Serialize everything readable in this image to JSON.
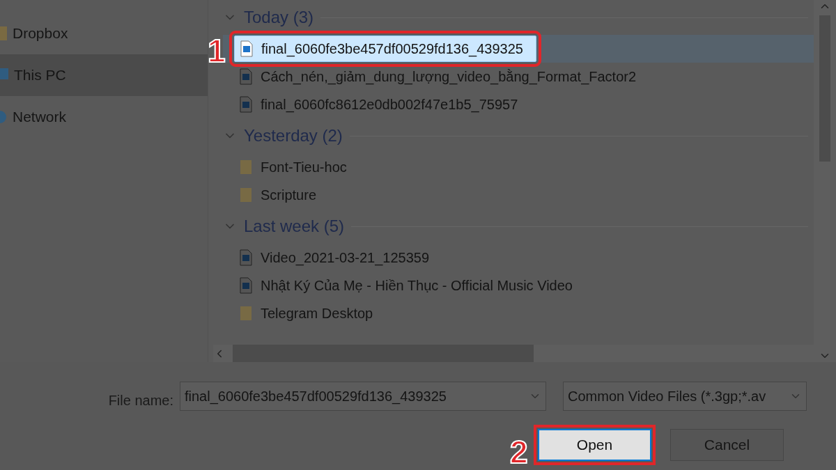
{
  "sidebar": {
    "items": [
      {
        "label": "Dropbox",
        "kind": "dropbox",
        "selected": false
      },
      {
        "label": "This PC",
        "kind": "pc",
        "selected": true
      },
      {
        "label": "Network",
        "kind": "network",
        "selected": false
      }
    ]
  },
  "groups": [
    {
      "title": "Today (3)",
      "expanded": true,
      "items": [
        {
          "name": "final_6060fe3be457df00529fd136_439325",
          "kind": "video",
          "selected": true,
          "step": "1"
        },
        {
          "name": "Cách_nén,_giảm_dung_lượng_video_bằng_Format_Factor2",
          "kind": "video",
          "selected": false
        },
        {
          "name": "final_6060fc8612e0db002f47e1b5_75957",
          "kind": "video",
          "selected": false
        }
      ]
    },
    {
      "title": "Yesterday (2)",
      "expanded": true,
      "items": [
        {
          "name": "Font-Tieu-hoc",
          "kind": "folder",
          "selected": false
        },
        {
          "name": "Scripture",
          "kind": "folder",
          "selected": false
        }
      ]
    },
    {
      "title": "Last week (5)",
      "expanded": true,
      "items": [
        {
          "name": "Video_2021-03-21_125359",
          "kind": "video",
          "selected": false
        },
        {
          "name": "Nhật Ký Của Mẹ - Hiền Thục - Official Music Video",
          "kind": "video",
          "selected": false
        },
        {
          "name": "Telegram Desktop",
          "kind": "folder",
          "selected": false
        }
      ]
    }
  ],
  "file_name": {
    "label": "File name:",
    "value": "final_6060fe3be457df00529fd136_439325"
  },
  "file_type": {
    "value": "Common Video Files (*.3gp;*.av"
  },
  "buttons": [
    {
      "label": "Open",
      "kind": "primary",
      "step": "2"
    },
    {
      "label": "Cancel",
      "kind": "secondary"
    }
  ]
}
